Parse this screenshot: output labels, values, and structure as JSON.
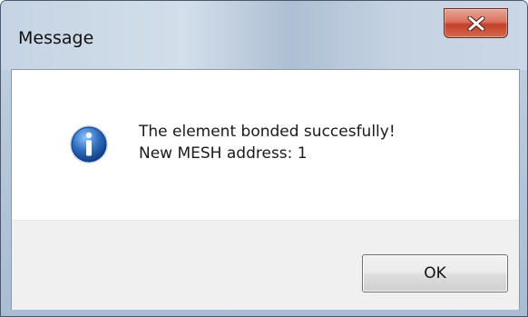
{
  "window": {
    "title": "Message"
  },
  "message": {
    "line1": "The element bonded succesfully!",
    "line2": "New MESH address: 1",
    "icon": "info-icon"
  },
  "buttons": {
    "ok_label": "OK",
    "close_icon": "close-icon"
  },
  "colors": {
    "close_button": "#c5402a",
    "info_icon": "#2f6fc0"
  }
}
